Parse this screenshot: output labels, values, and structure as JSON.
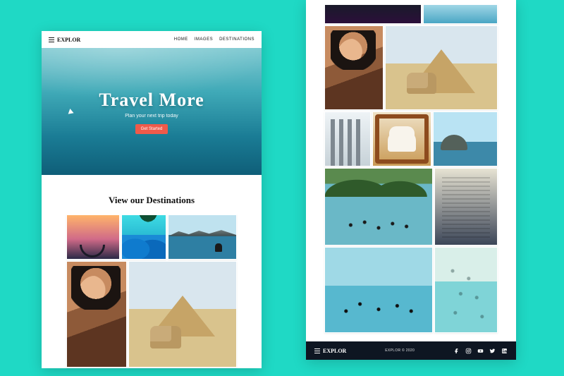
{
  "brand": "EXPLOR",
  "nav": {
    "items": [
      "Home",
      "Images",
      "Destinations"
    ]
  },
  "hero": {
    "title": "Travel More",
    "subtitle": "Plan your next trip today",
    "cta": "Get Started"
  },
  "gallery": {
    "heading": "View our Destinations"
  },
  "footer": {
    "copyright": "EXPLOR © 2020",
    "social_icons": [
      "facebook",
      "instagram",
      "youtube",
      "twitter",
      "linkedin"
    ]
  },
  "colors": {
    "background": "#1fd9c5",
    "cta": "#ef5a4a",
    "footer_bg": "#0e1622",
    "text_dark": "#111111",
    "text_light": "#ffffff"
  }
}
